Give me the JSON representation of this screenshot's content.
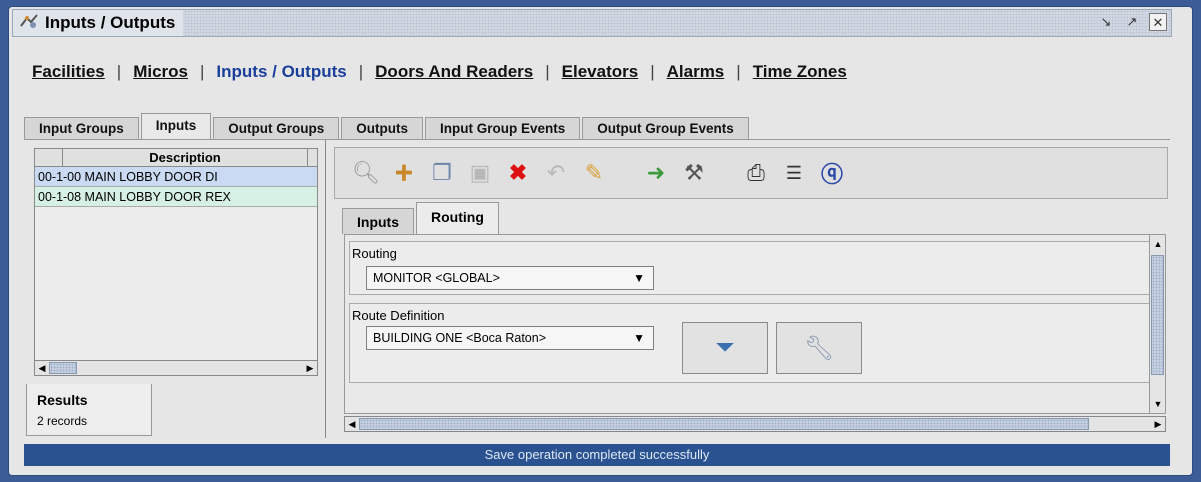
{
  "window": {
    "title": "Inputs / Outputs"
  },
  "nav": {
    "items": [
      {
        "label": "Facilities",
        "active": false
      },
      {
        "label": "Micros",
        "active": false
      },
      {
        "label": "Inputs / Outputs",
        "active": true
      },
      {
        "label": "Doors And Readers",
        "active": false
      },
      {
        "label": "Elevators",
        "active": false
      },
      {
        "label": "Alarms",
        "active": false
      },
      {
        "label": "Time Zones",
        "active": false
      }
    ],
    "separator": "|"
  },
  "tabs": [
    "Input Groups",
    "Inputs",
    "Output Groups",
    "Outputs",
    "Input Group Events",
    "Output Group Events"
  ],
  "active_tab": "Inputs",
  "grid": {
    "column": "Description",
    "rows": [
      "00-1-00 MAIN LOBBY DOOR DI",
      "00-1-08 MAIN LOBBY DOOR REX"
    ]
  },
  "results": {
    "title": "Results",
    "count": "2 records"
  },
  "toolbar": {
    "icons": [
      "search-icon",
      "add-icon",
      "copy-icon",
      "save-icon",
      "delete-icon",
      "undo-icon",
      "edit-icon",
      "forward-icon",
      "tools-icon",
      "print-icon",
      "list-icon",
      "help-icon"
    ]
  },
  "subtabs": [
    "Inputs",
    "Routing"
  ],
  "active_subtab": "Routing",
  "routing": {
    "label": "Routing",
    "value": "MONITOR <GLOBAL>"
  },
  "route_definition": {
    "label": "Route Definition",
    "value": "BUILDING ONE <Boca Raton>"
  },
  "status": "Save operation completed successfully",
  "colors": {
    "status_bar": "#2a5190",
    "active_nav": "#1a3f9a",
    "selected_row": "#c9daf2",
    "alt_row": "#d6f0e4"
  }
}
